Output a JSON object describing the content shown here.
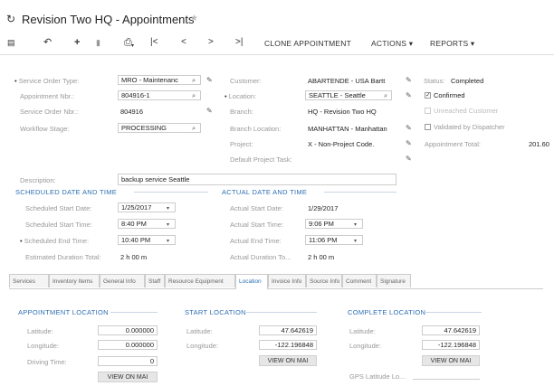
{
  "header": {
    "title": "Revision Two HQ - Appointments"
  },
  "toolbar": {
    "clone": "CLONE APPOINTMENT",
    "actions": "ACTIONS",
    "reports": "REPORTS"
  },
  "form": {
    "service_order_type": {
      "label": "Service Order Type:",
      "value": "MRO - Maintenanc"
    },
    "appointment_nbr": {
      "label": "Appointment Nbr.:",
      "value": "804916-1"
    },
    "service_order_nbr": {
      "label": "Service Order Nbr.:",
      "value": "804916"
    },
    "workflow_stage": {
      "label": "Workflow Stage:",
      "value": "PROCESSING"
    },
    "customer": {
      "label": "Customer:",
      "value": "ABARTENDE - USA Bartt"
    },
    "location": {
      "label": "Location:",
      "value": "SEATTLE - Seattle"
    },
    "branch": {
      "label": "Branch:",
      "value": "HQ - Revision Two HQ"
    },
    "branch_location": {
      "label": "Branch Location:",
      "value": "MANHATTAN - Manhattan"
    },
    "project": {
      "label": "Project:",
      "value": "X - Non-Project Code."
    },
    "default_project_task": {
      "label": "Default Project Task:"
    },
    "status": {
      "label": "Status:",
      "value": "Completed"
    },
    "confirmed": {
      "label": "Confirmed",
      "checked": true
    },
    "unreached_customer": {
      "label": "Unreached Customer",
      "checked": false
    },
    "validated_by_dispatcher": {
      "label": "Validated by Dispatcher",
      "checked": false
    },
    "appointment_total": {
      "label": "Appointment Total:",
      "value": "201.60"
    },
    "description": {
      "label": "Description:",
      "value": "backup service Seattle"
    }
  },
  "scheduled": {
    "heading": "SCHEDULED DATE AND TIME",
    "start_date": {
      "label": "Scheduled Start Date:",
      "value": "1/25/2017"
    },
    "start_time": {
      "label": "Scheduled Start Time:",
      "value": "8:40 PM"
    },
    "end_time": {
      "label": "Scheduled End Time:",
      "value": "10:40 PM"
    },
    "estimated_duration": {
      "label": "Estimated Duration Total:",
      "value": "2 h 00 m"
    }
  },
  "actual": {
    "heading": "ACTUAL DATE AND TIME",
    "start_date": {
      "label": "Actual Start Date:",
      "value": "1/29/2017"
    },
    "start_time": {
      "label": "Actual Start Time:",
      "value": "9:06 PM"
    },
    "end_time": {
      "label": "Actual End Time:",
      "value": "11:06 PM"
    },
    "duration": {
      "label": "Actual Duration To...",
      "value": "2 h 00 m"
    }
  },
  "tabs": [
    "Services",
    "Inventory Items",
    "General Info",
    "Staff",
    "Resource Equipment",
    "Location",
    "Invoice Info",
    "Source Info",
    "Comment",
    "Signature"
  ],
  "active_tab": "Location",
  "appointment_location": {
    "heading": "APPOINTMENT LOCATION",
    "latitude": {
      "label": "Latitude:",
      "value": "0.000000"
    },
    "longitude": {
      "label": "Longitude:",
      "value": "0.000000"
    },
    "driving_time": {
      "label": "Driving Time:",
      "value": "0"
    },
    "button": "VIEW ON MAI"
  },
  "start_location": {
    "heading": "START LOCATION",
    "latitude": {
      "label": "Latitude:",
      "value": "47.642619"
    },
    "longitude": {
      "label": "Longitude:",
      "value": "-122.196848"
    },
    "button": "VIEW ON MAI"
  },
  "complete_location": {
    "heading": "COMPLETE LOCATION",
    "latitude": {
      "label": "Latitude:",
      "value": "47.642619"
    },
    "longitude": {
      "label": "Longitude:",
      "value": "-122.196848"
    },
    "button": "VIEW ON MAI",
    "gps_latitude": {
      "label": "GPS Latitude Lo..."
    }
  },
  "colors": {
    "accent": "#2c6fb3",
    "tab_active": "#2c6fb3"
  }
}
